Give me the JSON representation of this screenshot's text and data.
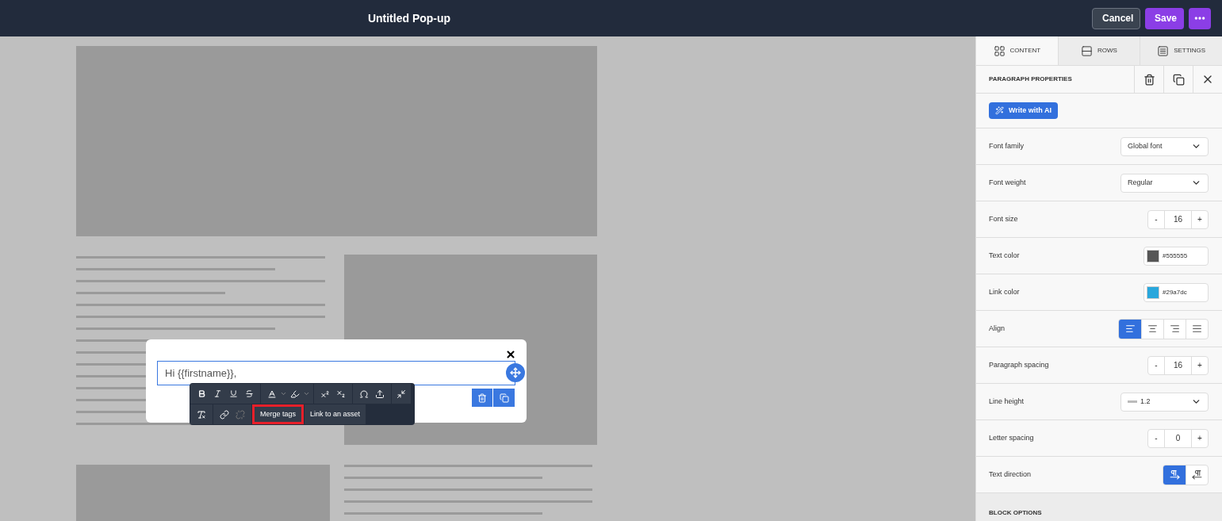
{
  "topbar": {
    "title": "Untitled Pop-up",
    "buttons": [
      {
        "label": "Cancel",
        "kind": "secondary"
      },
      {
        "label": "Save",
        "kind": "primary"
      }
    ]
  },
  "editor": {
    "text": "Hi {{firstname}},",
    "toolbar_buttons": [
      {
        "label": "Merge tags",
        "highlighted": true
      },
      {
        "label": "Link to an asset",
        "highlighted": false
      }
    ]
  },
  "panel": {
    "tabs": [
      {
        "label": "CONTENT",
        "selected": true
      },
      {
        "label": "ROWS",
        "selected": false
      },
      {
        "label": "SETTINGS",
        "selected": false
      }
    ],
    "title": "PARAGRAPH PROPERTIES",
    "ai_button": "Write with AI",
    "properties": [
      {
        "label": "Font family",
        "kind": "select",
        "value": "Global font"
      },
      {
        "label": "Font weight",
        "kind": "select",
        "value": "Regular"
      },
      {
        "label": "Font size",
        "kind": "stepper",
        "value": "16",
        "minus": "-",
        "plus": "+"
      },
      {
        "label": "Text color",
        "kind": "color",
        "value": "#555555",
        "color": "#555555"
      },
      {
        "label": "Link color",
        "kind": "color",
        "value": "#29a7dc",
        "color": "#29a7dc"
      },
      {
        "label": "Align",
        "kind": "align",
        "options": [
          {
            "selected": true
          },
          {
            "selected": false
          },
          {
            "selected": false
          },
          {
            "selected": false
          }
        ]
      },
      {
        "label": "Paragraph spacing",
        "kind": "stepper",
        "value": "16",
        "minus": "-",
        "plus": "+"
      },
      {
        "label": "Line height",
        "kind": "lineheight",
        "value": "1.2"
      },
      {
        "label": "Letter spacing",
        "kind": "stepper",
        "value": "0",
        "minus": "-",
        "plus": "+"
      },
      {
        "label": "Text direction",
        "kind": "direction",
        "options": [
          {
            "selected": true
          },
          {
            "selected": false
          }
        ]
      }
    ],
    "section": "BLOCK OPTIONS"
  }
}
